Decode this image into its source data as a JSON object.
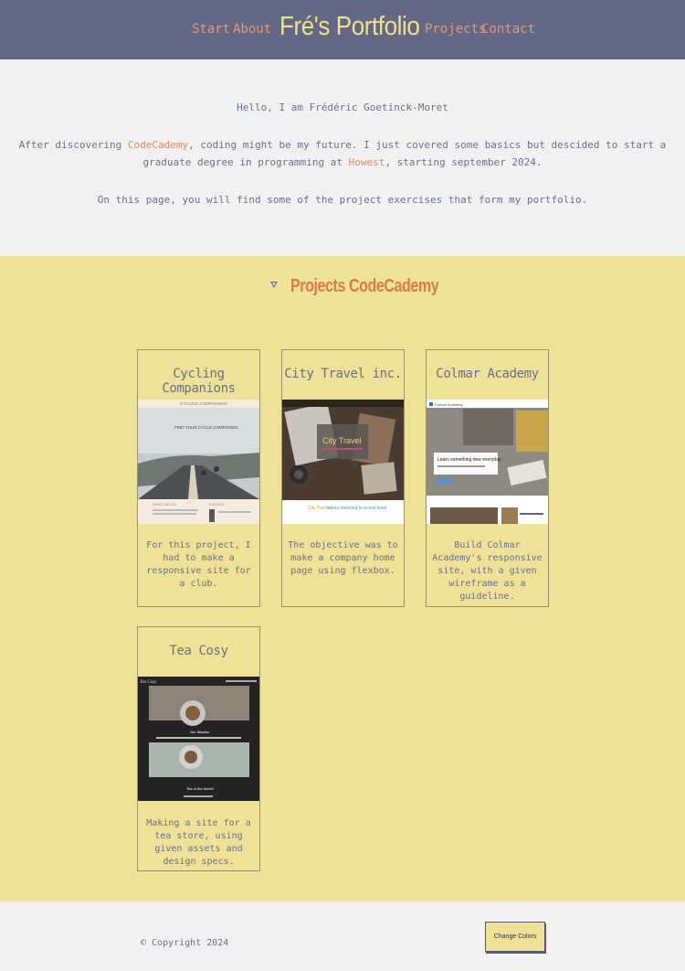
{
  "nav": {
    "links_left": [
      "Start",
      "About"
    ],
    "brand": "Fré's Portfolio",
    "links_right": [
      "Projects",
      "Contact"
    ]
  },
  "intro": {
    "greeting": "Hello, I am Frédéric Goetinck-Moret",
    "p2_before": "After discovering ",
    "p2_link1": "CodeCademy",
    "p2_mid": ", coding might be my future. I just covered some basics but descided to start a graduate degree in programming at ",
    "p2_link2": "Howest",
    "p2_after": ", starting september 2024.",
    "p3": "On this page, you will find some of the project exercises that form my portfolio."
  },
  "projects": {
    "heading": "Projects CodeCademy",
    "cards": [
      {
        "title": "Cycling Companions",
        "desc": "For this project, I had to make a responsive site for a club.",
        "thumb_text": [
          "CYCLING COMPANIONS",
          "FIND YOUR CYCLE COMPANION",
          "WHAT WE DO",
          "EVENTS"
        ]
      },
      {
        "title": "City Travel inc.",
        "desc": "The objective was to make a company home page using flexbox.",
        "thumb_text": [
          "City Travel",
          "City Travel",
          "takes traveling to a new level"
        ]
      },
      {
        "title": "Colmar Academy",
        "desc": "Build Colmar Academy's responsive site, with a given wireframe as a guideline.",
        "thumb_text": [
          "Learn something new everyday",
          "Colmar Academy"
        ]
      },
      {
        "title": "Tea Cosy",
        "desc": "Making a site for a tea store, using given assets and design specs.",
        "thumb_text": [
          "Tea Cozy",
          "Our Mission",
          "Tea of the Month"
        ]
      }
    ]
  },
  "footer": {
    "copyright": "© Copyright 2024",
    "button": "Change Colors"
  },
  "colors": {
    "nav_bg": "#626885",
    "accent": "#e08a5f",
    "brand": "#ede08f",
    "projects_bg": "#ede296",
    "text": "#6b6f8e"
  }
}
